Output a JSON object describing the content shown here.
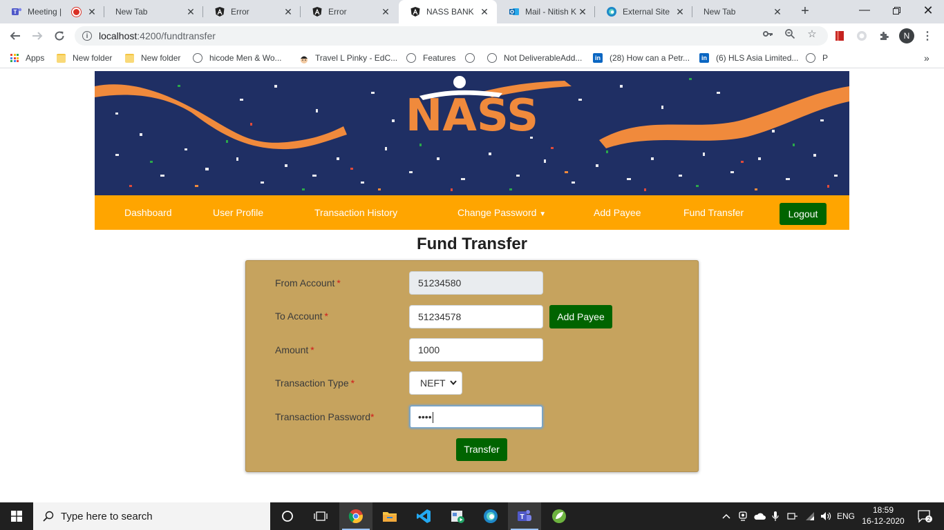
{
  "browser": {
    "tabs": [
      {
        "title": "Meeting |",
        "icon": "teams-icon"
      },
      {
        "title": "New Tab",
        "icon": ""
      },
      {
        "title": "Error",
        "icon": "angular-icon"
      },
      {
        "title": "Error",
        "icon": "angular-icon"
      },
      {
        "title": "NASS BANK",
        "icon": "angular-icon",
        "active": true
      },
      {
        "title": "Mail - Nitish K",
        "icon": "outlook-icon"
      },
      {
        "title": "External Site",
        "icon": "edge-icon"
      },
      {
        "title": "New Tab",
        "icon": ""
      }
    ],
    "url_host": "localhost",
    "url_path": ":4200/fundtransfer",
    "profile_initial": "N",
    "bookmarks": [
      {
        "label": "Apps"
      },
      {
        "label": "New folder"
      },
      {
        "label": "New folder"
      },
      {
        "label": "hicode Men & Wo..."
      },
      {
        "label": "Travel L Pinky - EdC..."
      },
      {
        "label": "Features"
      },
      {
        "label": ""
      },
      {
        "label": "Not DeliverableAdd..."
      },
      {
        "label": "(28) How can a Petr..."
      },
      {
        "label": "(6) HLS Asia Limited..."
      },
      {
        "label": "P"
      }
    ]
  },
  "banner": {
    "logo_text": "NASS"
  },
  "nav": {
    "dashboard": "Dashboard",
    "user_profile": "User Profile",
    "transaction_history": "Transaction History",
    "change_password": "Change Password",
    "add_payee": "Add Payee",
    "fund_transfer": "Fund Transfer",
    "logout": "Logout"
  },
  "page": {
    "title": "Fund Transfer"
  },
  "form": {
    "from_account": {
      "label": "From Account",
      "value": "51234580"
    },
    "to_account": {
      "label": "To Account",
      "value": "51234578"
    },
    "amount": {
      "label": "Amount",
      "value": "1000"
    },
    "transaction_type": {
      "label": "Transaction Type",
      "value": "NEFT"
    },
    "transaction_password": {
      "label": "Transaction Password",
      "value": "••••"
    },
    "required_mark": "*",
    "add_payee_button": "Add Payee",
    "transfer_button": "Transfer"
  },
  "taskbar": {
    "search_placeholder": "Type here to search",
    "language": "ENG",
    "time": "18:59",
    "date": "16-12-2020",
    "notification_count": "2"
  },
  "colors": {
    "nav_bg": "#ffa500",
    "button_green": "#006400",
    "form_bg": "#c6a35e",
    "banner_bg": "#1f2f64",
    "ribbon": "#f08a3c"
  }
}
